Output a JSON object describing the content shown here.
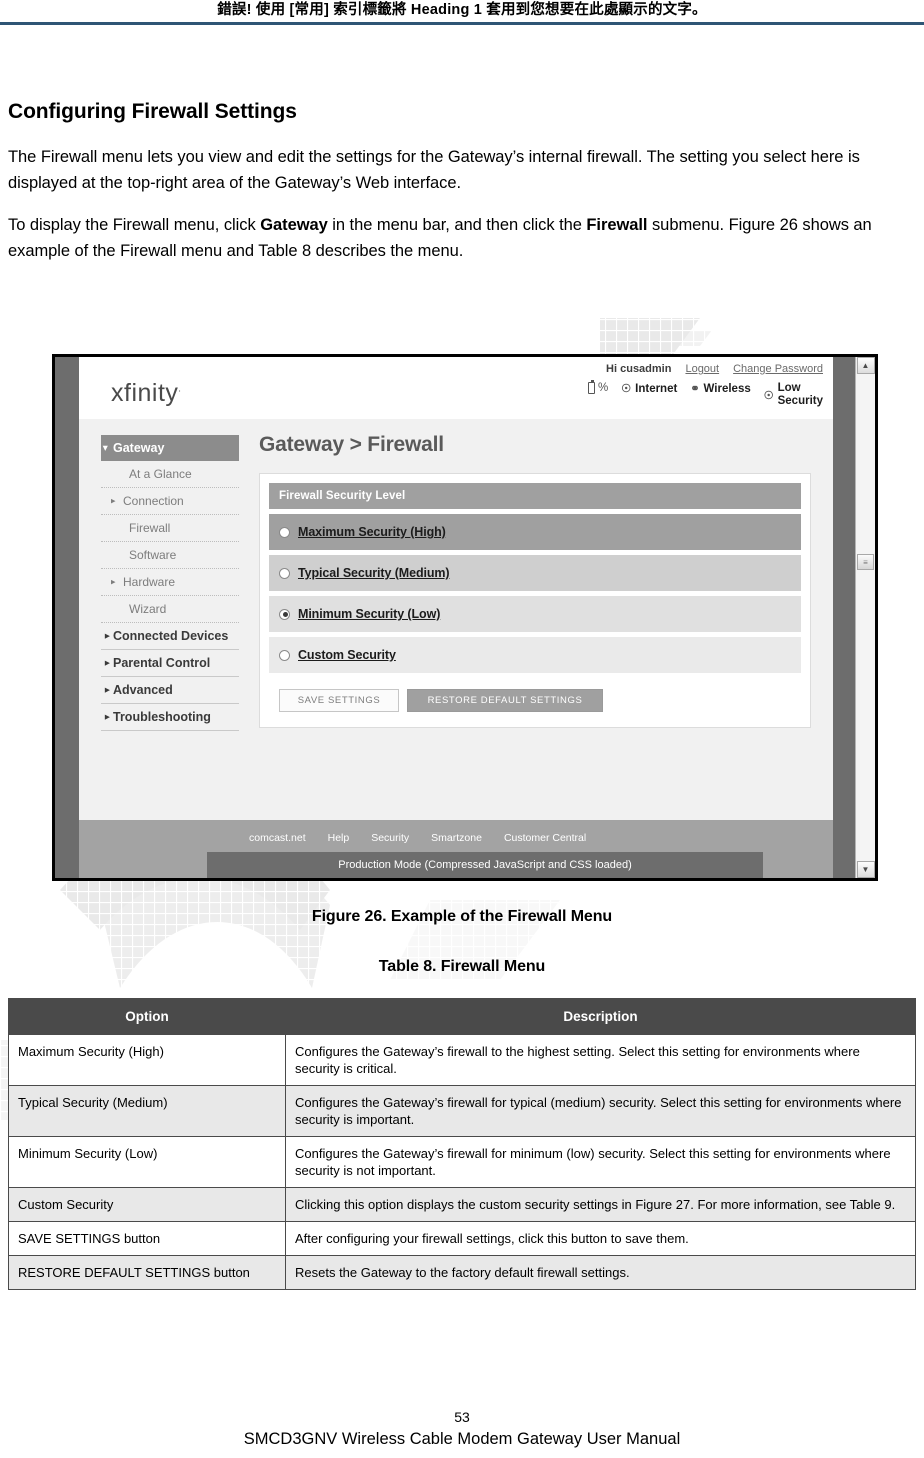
{
  "document": {
    "running_header": "錯誤! 使用 [常用] 索引標籤將 Heading 1 套用到您想要在此處顯示的文字。",
    "section_title": "Configuring Firewall Settings",
    "paragraph_1": "The Firewall menu lets you view and edit the settings for the Gateway’s internal firewall. The setting you select here is displayed at the top-right area of the Gateway’s Web interface.",
    "paragraph_2_part1": "To display the Firewall menu, click ",
    "paragraph_2_bold1": "Gateway",
    "paragraph_2_part2": " in the menu bar, and then click the ",
    "paragraph_2_bold2": "Firewall",
    "paragraph_2_part3": " submenu. Figure 26 shows an example of the Firewall menu and Table 8 describes the menu.",
    "figure_caption": "Figure 26. Example of the Firewall Menu",
    "table_caption": "Table 8. Firewall Menu",
    "page_number": "53",
    "footer_text": "SMCD3GNV Wireless Cable Modem Gateway User Manual"
  },
  "screenshot": {
    "brand": "xfinity",
    "account": {
      "greeting": "Hi cusadmin",
      "logout": "Logout",
      "change_password": "Change Password"
    },
    "status": {
      "battery_percent": "%",
      "internet": "Internet",
      "wireless": "Wireless",
      "security_line1": "Low",
      "security_line2": "Security"
    },
    "sidebar": [
      {
        "label": "Gateway",
        "level": "top",
        "state": "active",
        "caret": "down"
      },
      {
        "label": "At a Glance",
        "level": "sub",
        "state": "normal",
        "caret": "none"
      },
      {
        "label": "Connection",
        "level": "sub",
        "state": "normal",
        "caret": "right"
      },
      {
        "label": "Firewall",
        "level": "sub",
        "state": "current",
        "caret": "none"
      },
      {
        "label": "Software",
        "level": "sub",
        "state": "normal",
        "caret": "none"
      },
      {
        "label": "Hardware",
        "level": "sub",
        "state": "normal",
        "caret": "right"
      },
      {
        "label": "Wizard",
        "level": "sub",
        "state": "normal",
        "caret": "none"
      },
      {
        "label": "Connected Devices",
        "level": "top",
        "state": "normal",
        "caret": "right"
      },
      {
        "label": "Parental Control",
        "level": "top",
        "state": "normal",
        "caret": "right"
      },
      {
        "label": "Advanced",
        "level": "top",
        "state": "normal",
        "caret": "right"
      },
      {
        "label": "Troubleshooting",
        "level": "top",
        "state": "normal",
        "caret": "right"
      }
    ],
    "page_heading": "Gateway > Firewall",
    "panel_heading": "Firewall Security Level",
    "options": [
      {
        "label": "Maximum Security (High)",
        "selected": false,
        "shade": "#a0a0a0"
      },
      {
        "label": "Typical Security (Medium)",
        "selected": false,
        "shade": "#cfcfcf"
      },
      {
        "label": "Minimum Security (Low)",
        "selected": true,
        "shade": "#e0e0e0"
      },
      {
        "label": "Custom Security",
        "selected": false,
        "shade": "#eaeaea"
      }
    ],
    "buttons": {
      "save": "SAVE SETTINGS",
      "restore": "RESTORE DEFAULT SETTINGS"
    },
    "footer_links": [
      "comcast.net",
      "Help",
      "Security",
      "Smartzone",
      "Customer Central"
    ],
    "production_mode": "Production Mode (Compressed JavaScript and CSS loaded)"
  },
  "table": {
    "headers": [
      "Option",
      "Description"
    ],
    "rows": [
      {
        "option": "Maximum Security (High)",
        "description": "Configures the Gateway’s firewall to the highest setting. Select this setting for environments where security is critical."
      },
      {
        "option": "Typical Security (Medium)",
        "description": "Configures the Gateway’s firewall for typical (medium) security. Select this setting for environments where security is important."
      },
      {
        "option": "Minimum Security (Low)",
        "description": "Configures the Gateway’s firewall for minimum (low) security. Select this setting for environments where security is not important."
      },
      {
        "option": "Custom Security",
        "description": "Clicking this option displays the custom security settings in Figure 27. For more information, see Table 9."
      },
      {
        "option": "SAVE SETTINGS button",
        "description": "After configuring your firewall settings, click this button to save them."
      },
      {
        "option": "RESTORE DEFAULT SETTINGS button",
        "description": "Resets the Gateway to the factory default firewall settings."
      }
    ]
  },
  "colors": {
    "header_rule": "#2e5575",
    "table_header_bg": "#4a4a4a",
    "panel_head_bg": "#a0a0a0"
  }
}
